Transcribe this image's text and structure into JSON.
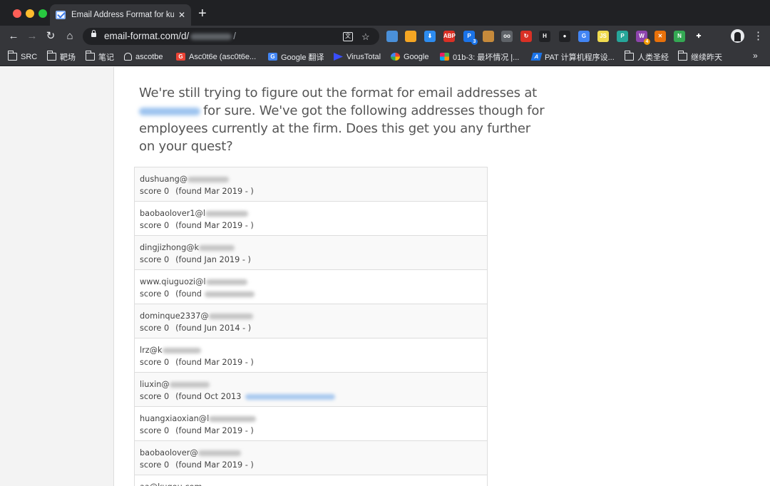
{
  "window": {
    "tab_title": "Email Address Format for kugo",
    "tab_close": "✕",
    "new_tab": "+"
  },
  "toolbar": {
    "back": "←",
    "forward": "→",
    "reload": "↻",
    "home": "⌂",
    "url_prefix": "email-format.com/d/",
    "url_suffix": "/",
    "star": "☆",
    "translate": "文",
    "menu": "⋮"
  },
  "extensions": [
    {
      "icon": "photo-extension-icon",
      "color": "#4a90d9",
      "label": ""
    },
    {
      "icon": "chart-extension-icon",
      "color": "#f5a623",
      "label": ""
    },
    {
      "icon": "download-extension-icon",
      "color": "#2d8cf0",
      "label": "⬇"
    },
    {
      "icon": "adblock-extension-icon",
      "color": "#d93025",
      "label": "ABP"
    },
    {
      "icon": "proxy-extension-icon",
      "color": "#1a73e8",
      "label": "P",
      "badge": "3"
    },
    {
      "icon": "cookie-extension-icon",
      "color": "#c68a3b",
      "label": ""
    },
    {
      "icon": "glasses-extension-icon",
      "color": "#5f6368",
      "label": "oo"
    },
    {
      "icon": "redirect-extension-icon",
      "color": "#d93025",
      "label": "↻"
    },
    {
      "icon": "hackbar-extension-icon",
      "color": "#202124",
      "label": "H"
    },
    {
      "icon": "circle-extension-icon",
      "color": "#202124",
      "label": "●"
    },
    {
      "icon": "translate-extension-icon",
      "color": "#4285f4",
      "label": "G"
    },
    {
      "icon": "js-extension-icon",
      "color": "#f0db4f",
      "label": "JS"
    },
    {
      "icon": "p-extension-icon",
      "color": "#26a69a",
      "label": "P"
    },
    {
      "icon": "wappalyzer-extension-icon",
      "color": "#8e44ad",
      "label": "W",
      "badge": "4"
    },
    {
      "icon": "x-extension-icon",
      "color": "#e8710a",
      "label": "✕"
    },
    {
      "icon": "n-extension-icon",
      "color": "#34a853",
      "label": "N"
    },
    {
      "icon": "puzzle-icon",
      "color": "#35363a",
      "label": "✚"
    }
  ],
  "bookmarks": [
    {
      "icon": "folder",
      "label": "SRC"
    },
    {
      "icon": "folder",
      "label": "靶场"
    },
    {
      "icon": "folder",
      "label": "笔记"
    },
    {
      "icon": "user",
      "label": "ascotbe"
    },
    {
      "icon": "g",
      "label": "Asc0t6e (asc0t6e..."
    },
    {
      "icon": "gt",
      "label": "Google 翻译"
    },
    {
      "icon": "vt",
      "label": "VirusTotal"
    },
    {
      "icon": "goog",
      "label": "Google"
    },
    {
      "icon": "gr",
      "label": "01b-3: 最坏情况 |..."
    },
    {
      "icon": "pat",
      "label": "PAT 计算机程序设..."
    },
    {
      "icon": "folder",
      "label": "人类圣经"
    },
    {
      "icon": "folder",
      "label": "继续昨天"
    }
  ],
  "bookmarks_more": "»",
  "intro": {
    "line1": "We're still trying to figure out the format for email addresses at",
    "line2": "for sure. We've got the following addresses though for employees currently at the firm. Does this get you any further on your quest?"
  },
  "emails": [
    {
      "user": "dushuang@",
      "score": "score 0",
      "found": "(found Mar 2019 - )",
      "blur_w": 58
    },
    {
      "user": "baobaolover1@l",
      "score": "score 0",
      "found": "(found Mar 2019 - )",
      "blur_w": 60
    },
    {
      "user": "dingjizhong@k",
      "score": "score 0",
      "found": "(found Jan 2019 - )",
      "blur_w": 50
    },
    {
      "user": "www.qiuguozi@l",
      "score": "score 0",
      "found": "(found",
      "blur_w": 58,
      "found_blur": 70
    },
    {
      "user": "dominque2337@",
      "score": "score 0",
      "found": "(found Jun 2014 - )",
      "blur_w": 62
    },
    {
      "user": "lrz@k",
      "score": "score 0",
      "found": "(found Mar 2019 - )",
      "blur_w": 54
    },
    {
      "user": "liuxin@",
      "score": "score 0",
      "found": "(found Oct 2013",
      "blur_w": 56,
      "found_blue_blur": 126
    },
    {
      "user": "huangxiaoxian@l",
      "score": "score 0",
      "found": "(found Mar 2019 - )",
      "blur_w": 66
    },
    {
      "user": "baobaolover@",
      "score": "score 0",
      "found": "(found Mar 2019 - )",
      "blur_w": 60
    },
    {
      "user": "aa@kugou.com",
      "score": "",
      "found": "",
      "blur_w": 0
    }
  ]
}
